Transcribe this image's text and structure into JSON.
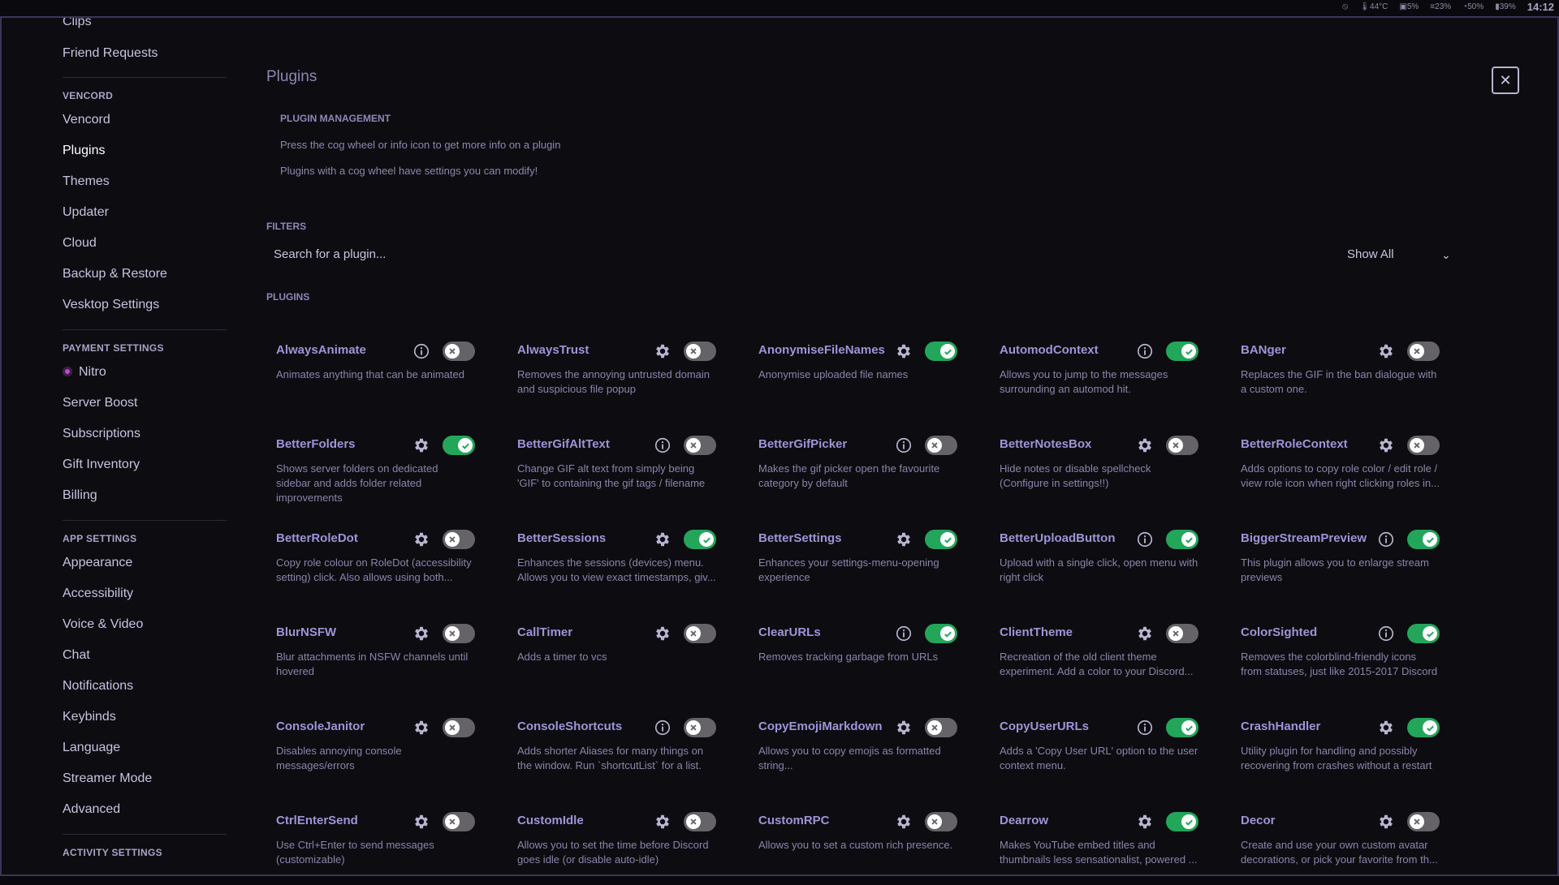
{
  "system_bar": {
    "tray": [
      "44°C",
      "5%",
      "23%",
      "50%",
      "39%"
    ],
    "clock": "14:12"
  },
  "sidebar": {
    "top_items": [
      {
        "label": "Clips"
      },
      {
        "label": "Friend Requests"
      }
    ],
    "sections": [
      {
        "header": "VENCORD",
        "items": [
          "Vencord",
          "Plugins",
          "Themes",
          "Updater",
          "Cloud",
          "Backup & Restore",
          "Vesktop Settings"
        ]
      },
      {
        "header": "PAYMENT SETTINGS",
        "items": [
          "Nitro",
          "Server Boost",
          "Subscriptions",
          "Gift Inventory",
          "Billing"
        ]
      },
      {
        "header": "APP SETTINGS",
        "items": [
          "Appearance",
          "Accessibility",
          "Voice & Video",
          "Chat",
          "Notifications",
          "Keybinds",
          "Language",
          "Streamer Mode",
          "Advanced"
        ]
      },
      {
        "header": "ACTIVITY SETTINGS",
        "items": []
      }
    ],
    "active_item": "Plugins"
  },
  "main": {
    "title": "Plugins",
    "plugin_management": {
      "title": "PLUGIN MANAGEMENT",
      "lines": [
        "Press the cog wheel or info icon to get more info on a plugin",
        "Plugins with a cog wheel have settings you can modify!"
      ]
    },
    "filters": {
      "title": "FILTERS",
      "search_placeholder": "Search for a plugin...",
      "show_select": "Show All"
    },
    "plugins_title": "PLUGINS",
    "plugins": [
      {
        "name": "AlwaysAnimate",
        "desc": "Animates anything that can be animated",
        "icon": "info-icon",
        "enabled": false
      },
      {
        "name": "AlwaysTrust",
        "desc": "Removes the annoying untrusted domain and suspicious file popup",
        "icon": "cog-icon",
        "enabled": false
      },
      {
        "name": "AnonymiseFileNames",
        "desc": "Anonymise uploaded file names",
        "icon": "cog-icon",
        "enabled": true
      },
      {
        "name": "AutomodContext",
        "desc": "Allows you to jump to the messages surrounding an automod hit.",
        "icon": "info-icon",
        "enabled": true
      },
      {
        "name": "BANger",
        "desc": "Replaces the GIF in the ban dialogue with a custom one.",
        "icon": "cog-icon",
        "enabled": false
      },
      {
        "name": "BetterFolders",
        "desc": "Shows server folders on dedicated sidebar and adds folder related improvements",
        "icon": "cog-icon",
        "enabled": true
      },
      {
        "name": "BetterGifAltText",
        "desc": "Change GIF alt text from simply being 'GIF' to containing the gif tags / filename",
        "icon": "info-icon",
        "enabled": false
      },
      {
        "name": "BetterGifPicker",
        "desc": "Makes the gif picker open the favourite category by default",
        "icon": "info-icon",
        "enabled": false
      },
      {
        "name": "BetterNotesBox",
        "desc": "Hide notes or disable spellcheck (Configure in settings!!)",
        "icon": "cog-icon",
        "enabled": false
      },
      {
        "name": "BetterRoleContext",
        "desc": "Adds options to copy role color / edit role / view role icon when right clicking roles in...",
        "icon": "cog-icon",
        "enabled": false
      },
      {
        "name": "BetterRoleDot",
        "desc": "Copy role colour on RoleDot (accessibility setting) click. Also allows using both...",
        "icon": "cog-icon",
        "enabled": false
      },
      {
        "name": "BetterSessions",
        "desc": "Enhances the sessions (devices) menu. Allows you to view exact timestamps, giv...",
        "icon": "cog-icon",
        "enabled": true
      },
      {
        "name": "BetterSettings",
        "desc": "Enhances your settings-menu-opening experience",
        "icon": "cog-icon",
        "enabled": true
      },
      {
        "name": "BetterUploadButton",
        "desc": "Upload with a single click, open menu with right click",
        "icon": "info-icon",
        "enabled": true
      },
      {
        "name": "BiggerStreamPreview",
        "desc": "This plugin allows you to enlarge stream previews",
        "icon": "info-icon",
        "enabled": true
      },
      {
        "name": "BlurNSFW",
        "desc": "Blur attachments in NSFW channels until hovered",
        "icon": "cog-icon",
        "enabled": false
      },
      {
        "name": "CallTimer",
        "desc": "Adds a timer to vcs",
        "icon": "cog-icon",
        "enabled": false
      },
      {
        "name": "ClearURLs",
        "desc": "Removes tracking garbage from URLs",
        "icon": "info-icon",
        "enabled": true
      },
      {
        "name": "ClientTheme",
        "desc": "Recreation of the old client theme experiment. Add a color to your Discord...",
        "icon": "cog-icon",
        "enabled": false
      },
      {
        "name": "ColorSighted",
        "desc": "Removes the colorblind-friendly icons from statuses, just like 2015-2017 Discord",
        "icon": "info-icon",
        "enabled": true
      },
      {
        "name": "ConsoleJanitor",
        "desc": "Disables annoying console messages/errors",
        "icon": "cog-icon",
        "enabled": false
      },
      {
        "name": "ConsoleShortcuts",
        "desc": "Adds shorter Aliases for many things on the window. Run `shortcutList` for a list.",
        "icon": "info-icon",
        "enabled": false
      },
      {
        "name": "CopyEmojiMarkdown",
        "desc": "Allows you to copy emojis as formatted string...",
        "icon": "cog-icon",
        "enabled": false
      },
      {
        "name": "CopyUserURLs",
        "desc": "Adds a 'Copy User URL' option to the user context menu.",
        "icon": "info-icon",
        "enabled": true
      },
      {
        "name": "CrashHandler",
        "desc": "Utility plugin for handling and possibly recovering from crashes without a restart",
        "icon": "cog-icon",
        "enabled": true
      },
      {
        "name": "CtrlEnterSend",
        "desc": "Use Ctrl+Enter to send messages (customizable)",
        "icon": "cog-icon",
        "enabled": false
      },
      {
        "name": "CustomIdle",
        "desc": "Allows you to set the time before Discord goes idle (or disable auto-idle)",
        "icon": "cog-icon",
        "enabled": false
      },
      {
        "name": "CustomRPC",
        "desc": "Allows you to set a custom rich presence.",
        "icon": "cog-icon",
        "enabled": false
      },
      {
        "name": "Dearrow",
        "desc": "Makes YouTube embed titles and thumbnails less sensationalist, powered ...",
        "icon": "cog-icon",
        "enabled": true
      },
      {
        "name": "Decor",
        "desc": "Create and use your own custom avatar decorations, or pick your favorite from th...",
        "icon": "cog-icon",
        "enabled": false
      }
    ]
  },
  "colors": {
    "toggle_on": "#23a55a",
    "toggle_off": "#656368",
    "plugin_name": "#9d95d8",
    "frame_border": "#3b3658"
  }
}
